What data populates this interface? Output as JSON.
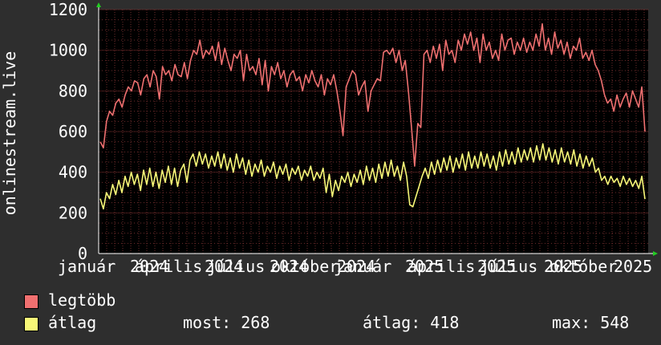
{
  "chart_data": {
    "type": "line",
    "ylabel": "onlinestream.live",
    "ylim": [
      0,
      1200
    ],
    "yticks": [
      0,
      200,
      400,
      600,
      800,
      1000,
      1200
    ],
    "x_tick_labels": [
      "január",
      "2024",
      "április",
      "2024",
      "július",
      "2024",
      "október",
      "2024",
      "január",
      "2025",
      "április",
      "2025",
      "július",
      "2025",
      "október",
      "2025"
    ],
    "grid": true,
    "colors": {
      "background": "#2e2e2e",
      "plot": "#000000",
      "grid": "#6e2b2b",
      "axis": "#ffffff",
      "arrow": "#22cc22"
    },
    "series": [
      {
        "name": "legtöbb",
        "color": "#f07070",
        "values": [
          550,
          520,
          650,
          700,
          680,
          740,
          760,
          720,
          780,
          820,
          800,
          850,
          840,
          780,
          860,
          880,
          820,
          900,
          870,
          760,
          920,
          880,
          900,
          850,
          930,
          880,
          870,
          940,
          860,
          950,
          1000,
          980,
          1050,
          960,
          1000,
          980,
          1020,
          950,
          1040,
          930,
          1010,
          950,
          900,
          980,
          960,
          1000,
          850,
          980,
          900,
          920,
          880,
          960,
          830,
          950,
          800,
          920,
          880,
          940,
          860,
          900,
          820,
          880,
          900,
          850,
          870,
          800,
          880,
          840,
          900,
          850,
          820,
          880,
          780,
          860,
          830,
          880,
          800,
          700,
          580,
          820,
          860,
          900,
          880,
          780,
          820,
          850,
          700,
          800,
          830,
          860,
          850,
          990,
          1000,
          980,
          1010,
          940,
          1000,
          900,
          950,
          800,
          620,
          430,
          640,
          620,
          980,
          1000,
          940,
          1020,
          960,
          1030,
          900,
          1050,
          980,
          1000,
          940,
          1050,
          1000,
          1080,
          1030,
          1090,
          1000,
          1060,
          940,
          1080,
          1000,
          1040,
          960,
          1000,
          950,
          1080,
          1000,
          1050,
          1060,
          980,
          1040,
          1000,
          1060,
          990,
          1040,
          1000,
          1080,
          1020,
          1130,
          1000,
          1060,
          980,
          1090,
          1010,
          1050,
          980,
          1040,
          960,
          1020,
          1000,
          1060,
          960,
          990,
          950,
          1000,
          930,
          900,
          850,
          780,
          740,
          760,
          700,
          780,
          720,
          760,
          790,
          720,
          800,
          760,
          720,
          820,
          600
        ]
      },
      {
        "name": "átlag",
        "color": "#f8f878",
        "values": [
          270,
          220,
          300,
          270,
          340,
          290,
          360,
          300,
          380,
          330,
          400,
          340,
          390,
          310,
          410,
          340,
          420,
          330,
          400,
          320,
          410,
          350,
          430,
          340,
          420,
          330,
          410,
          440,
          350,
          460,
          490,
          430,
          500,
          440,
          490,
          420,
          480,
          430,
          500,
          420,
          490,
          410,
          470,
          400,
          490,
          420,
          470,
          390,
          460,
          380,
          440,
          400,
          460,
          380,
          430,
          400,
          450,
          370,
          430,
          390,
          440,
          360,
          420,
          390,
          430,
          360,
          410,
          380,
          430,
          360,
          400,
          370,
          420,
          300,
          390,
          280,
          360,
          310,
          380,
          350,
          400,
          330,
          390,
          350,
          410,
          340,
          430,
          360,
          420,
          350,
          440,
          370,
          450,
          380,
          460,
          380,
          430,
          360,
          450,
          380,
          240,
          230,
          280,
          330,
          380,
          420,
          370,
          450,
          390,
          460,
          400,
          470,
          410,
          480,
          400,
          470,
          420,
          490,
          410,
          500,
          420,
          480,
          420,
          500,
          430,
          490,
          420,
          480,
          410,
          500,
          430,
          510,
          440,
          500,
          440,
          520,
          450,
          510,
          460,
          520,
          450,
          530,
          460,
          540,
          460,
          520,
          450,
          510,
          440,
          520,
          450,
          500,
          440,
          510,
          430,
          490,
          420,
          480,
          430,
          470,
          400,
          420,
          360,
          380,
          340,
          380,
          350,
          370,
          330,
          380,
          340,
          370,
          330,
          360,
          320,
          380,
          268
        ]
      }
    ]
  },
  "legend": {
    "items": [
      {
        "label": "legtöbb",
        "color": "#f07070"
      },
      {
        "label": "átlag",
        "color": "#f8f878"
      }
    ],
    "stats": {
      "now": "most: 268",
      "avg": "átlag: 418",
      "max": "max: 548"
    }
  }
}
